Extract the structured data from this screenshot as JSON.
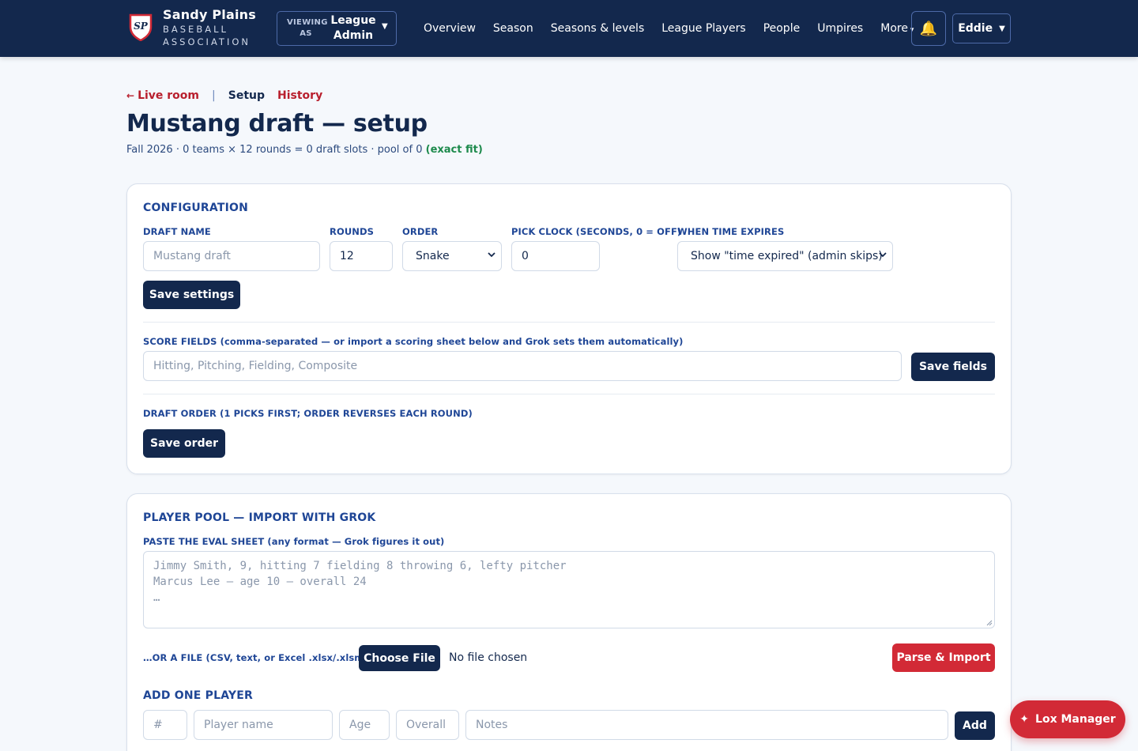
{
  "nav": {
    "brand_line1": "Sandy Plains",
    "brand_line2": "BASEBALL",
    "brand_line3": "ASSOCIATION",
    "logo_text": "SP",
    "viewing_label_1": "VIEWING",
    "viewing_label_2": "AS",
    "viewing_value_1": "League",
    "viewing_value_2": "Admin",
    "links": [
      "Overview",
      "Season",
      "Seasons & levels",
      "League Players",
      "People",
      "Umpires",
      "More"
    ],
    "user": "Eddie"
  },
  "crumbs": {
    "live": "Live room",
    "separator": "|",
    "current": "Setup",
    "history": "History"
  },
  "page": {
    "title": "Mustang draft — setup",
    "summary": "Fall 2026 · 0 teams × 12 rounds = 0 draft slots · pool of 0",
    "fit": "(exact fit)"
  },
  "config": {
    "title": "CONFIGURATION",
    "draft_name_label": "DRAFT NAME",
    "draft_name_placeholder": "Mustang draft",
    "rounds_label": "ROUNDS",
    "rounds_value": "12",
    "order_label": "ORDER",
    "order_value": "Snake",
    "clock_label": "PICK CLOCK (SECONDS, 0 = OFF)",
    "clock_value": "0",
    "expires_label": "WHEN TIME EXPIRES",
    "expires_value": "Show \"time expired\" (admin skips)",
    "save_settings": "Save settings",
    "score_label": "SCORE FIELDS (comma-separated — or import a scoring sheet below and Grok sets them automatically)",
    "score_placeholder": "Hitting, Pitching, Fielding, Composite",
    "save_fields": "Save fields",
    "order_section_label": "DRAFT ORDER (1 PICKS FIRST; ORDER REVERSES EACH ROUND)",
    "save_order": "Save order"
  },
  "pool": {
    "title": "PLAYER POOL — IMPORT WITH GROK",
    "paste_label": "PASTE THE EVAL SHEET (any format — Grok figures it out)",
    "paste_placeholder_lines": [
      "Jimmy Smith, 9, hitting 7 fielding 8 throwing 6, lefty pitcher",
      "Marcus Lee — age 10 — overall 24",
      "…"
    ],
    "file_label": "…OR A FILE (CSV, text, or Excel .xlsx/.xlsm):",
    "choose_file": "Choose File",
    "no_file": "No file chosen",
    "parse_import": "Parse & Import",
    "add_title": "ADD ONE PLAYER",
    "num_placeholder": "#",
    "name_placeholder": "Player name",
    "age_placeholder": "Age",
    "overall_placeholder": "Overall",
    "notes_placeholder": "Notes",
    "add_button": "Add"
  },
  "floating": {
    "label": "Lox Manager",
    "icon": "sparkle-icon"
  }
}
